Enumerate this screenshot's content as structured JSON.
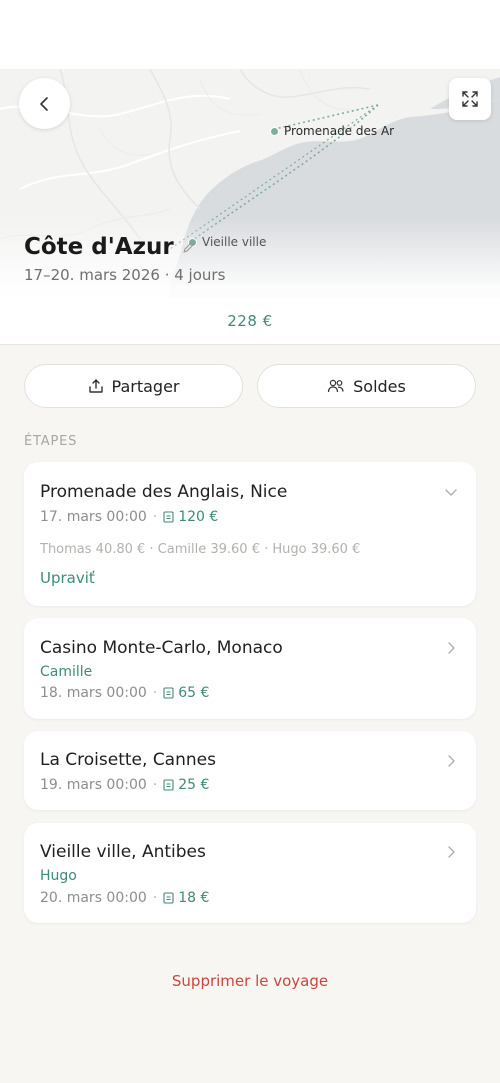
{
  "map": {
    "markers": [
      {
        "label": "Promenade des Ar"
      },
      {
        "label": "Vieille ville"
      }
    ]
  },
  "trip": {
    "title": "Côte d'Azur",
    "subtitle": "17–20. mars 2026 · 4 jours",
    "total": "228  €"
  },
  "actions": {
    "share_label": "Partager",
    "balances_label": "Soldes"
  },
  "section": {
    "stages_label": "ÉTAPES"
  },
  "stages": [
    {
      "title": "Promenade des Anglais, Nice",
      "date": "17. mars 00:00",
      "amount": "120  €",
      "split": "Thomas 40.80 € · Camille 39.60 € · Hugo 39.60 €",
      "edit_label": "Upraviť"
    },
    {
      "title": "Casino Monte-Carlo, Monaco",
      "payer": "Camille",
      "date": "18. mars 00:00",
      "amount": "65  €"
    },
    {
      "title": "La Croisette, Cannes",
      "date": "19. mars 00:00",
      "amount": "25  €"
    },
    {
      "title": "Vieille ville, Antibes",
      "payer": "Hugo",
      "date": "20. mars 00:00",
      "amount": "18  €"
    }
  ],
  "footer": {
    "delete_label": "Supprimer le voyage"
  },
  "colors": {
    "accent": "#3f8a78",
    "danger": "#c9463d",
    "background": "#f7f6f3"
  }
}
